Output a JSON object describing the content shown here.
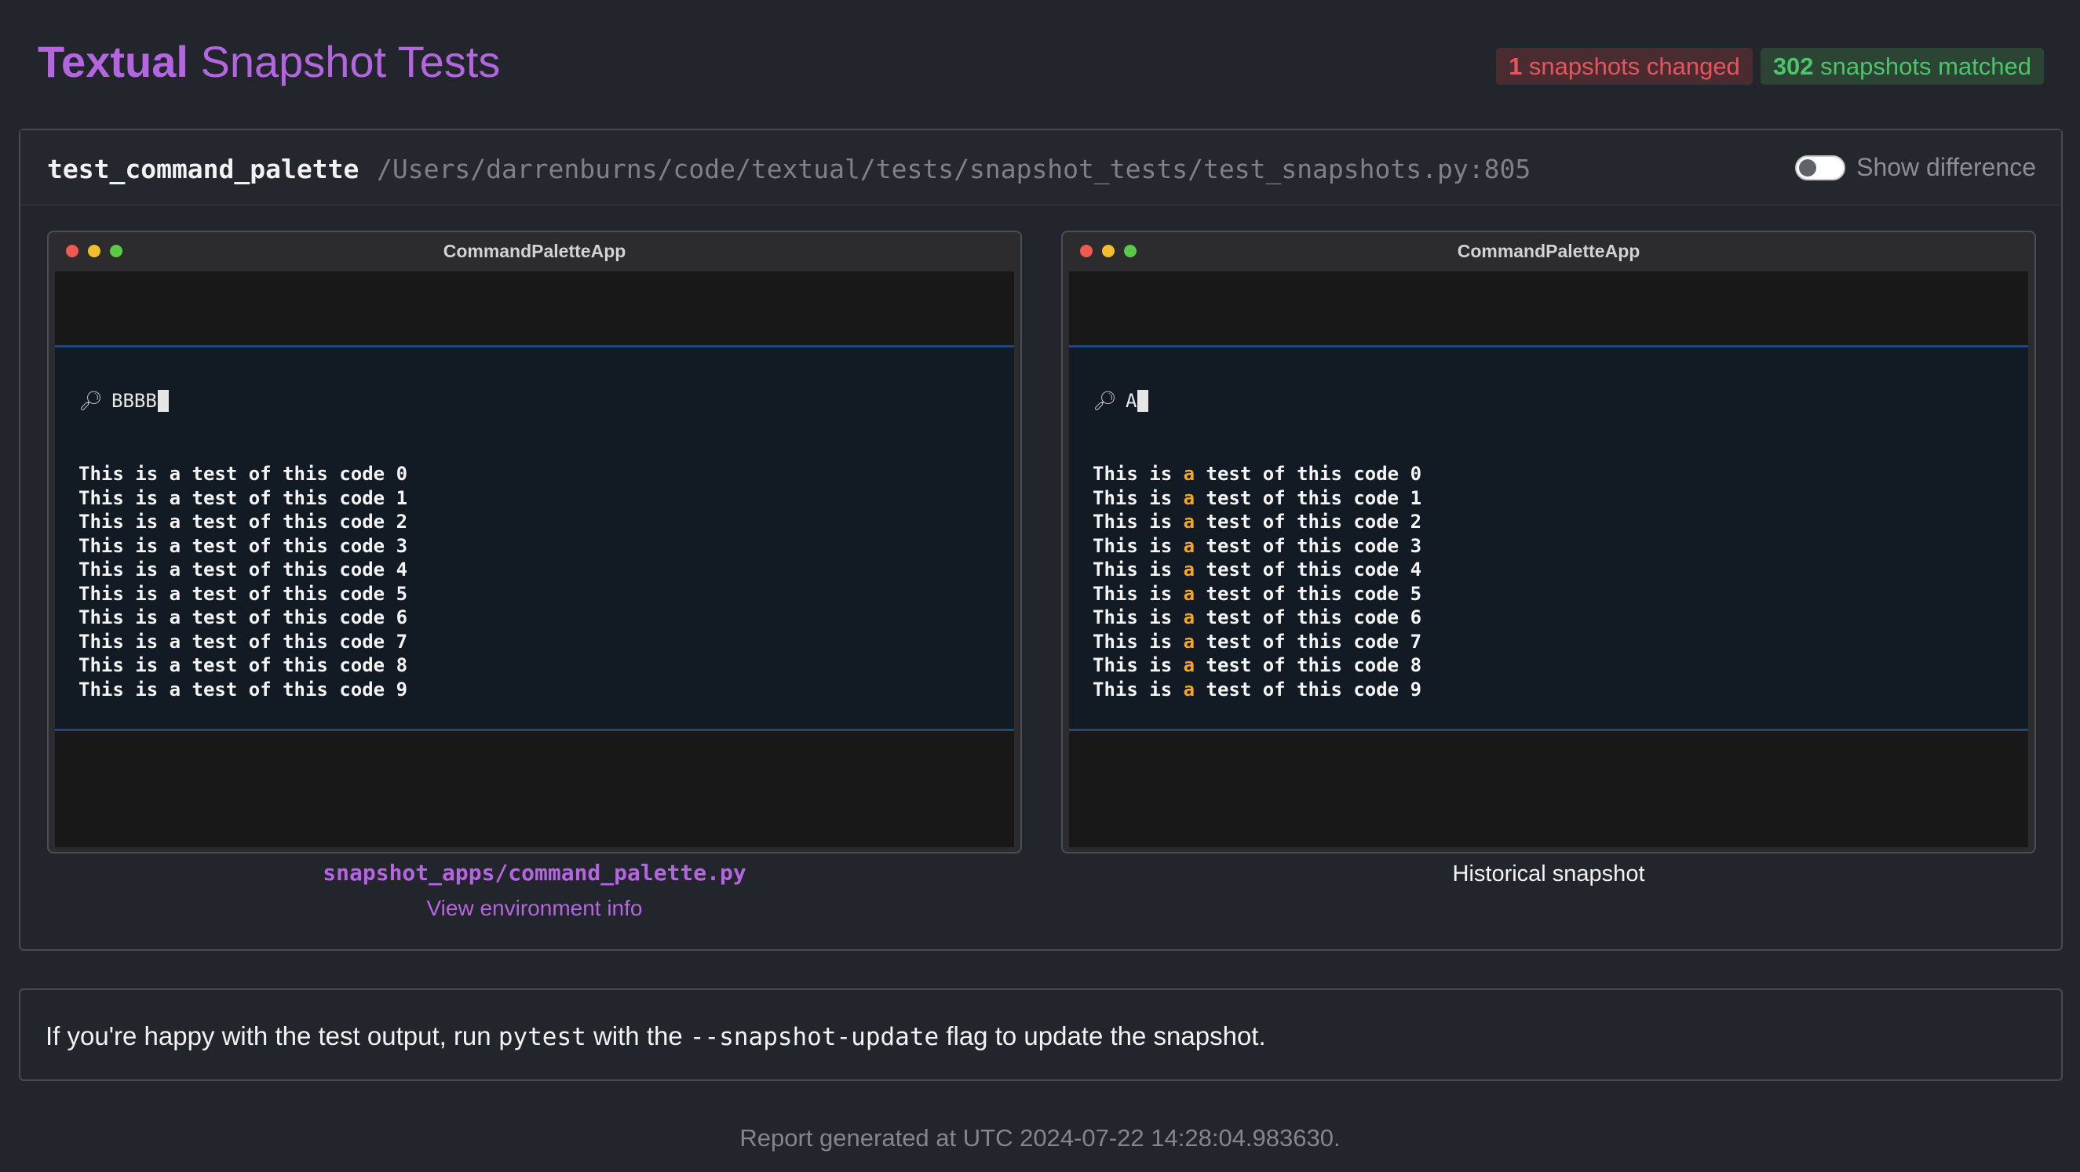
{
  "header": {
    "title_strong": "Textual",
    "title_rest": " Snapshot Tests",
    "changed_count": "1",
    "changed_label": " snapshots changed",
    "matched_count": "302",
    "matched_label": " snapshots matched"
  },
  "test": {
    "name": "test_command_palette",
    "path": "/Users/darrenburns/code/textual/tests/snapshot_tests/test_snapshots.py:805",
    "toggle_label": "Show difference",
    "toggle_on": false
  },
  "left_window": {
    "title": "CommandPaletteApp",
    "query": "BBBB",
    "results": [
      "This is a test of this code 0",
      "This is a test of this code 1",
      "This is a test of this code 2",
      "This is a test of this code 3",
      "This is a test of this code 4",
      "This is a test of this code 5",
      "This is a test of this code 6",
      "This is a test of this code 7",
      "This is a test of this code 8",
      "This is a test of this code 9"
    ],
    "caption_file": "snapshot_apps/command_palette.py",
    "caption_link": "View environment info"
  },
  "right_window": {
    "title": "CommandPaletteApp",
    "query": "A",
    "results": [
      "This is a test of this code 0",
      "This is a test of this code 1",
      "This is a test of this code 2",
      "This is a test of this code 3",
      "This is a test of this code 4",
      "This is a test of this code 5",
      "This is a test of this code 6",
      "This is a test of this code 7",
      "This is a test of this code 8",
      "This is a test of this code 9"
    ],
    "highlight_word": "a",
    "caption": "Historical snapshot"
  },
  "note": {
    "prefix": "If you're happy with the test output, run ",
    "cmd1": "pytest",
    "middle": " with the ",
    "cmd2": "--snapshot-update",
    "suffix": " flag to update the snapshot."
  },
  "footer": {
    "text": "Report generated at UTC 2024-07-22 14:28:04.983630."
  },
  "colors": {
    "accent": "#b466e0",
    "changed": "#e5555e",
    "matched": "#4ec46a",
    "highlight": "#f5a623"
  },
  "icons": {
    "search": "magnifier-icon"
  }
}
